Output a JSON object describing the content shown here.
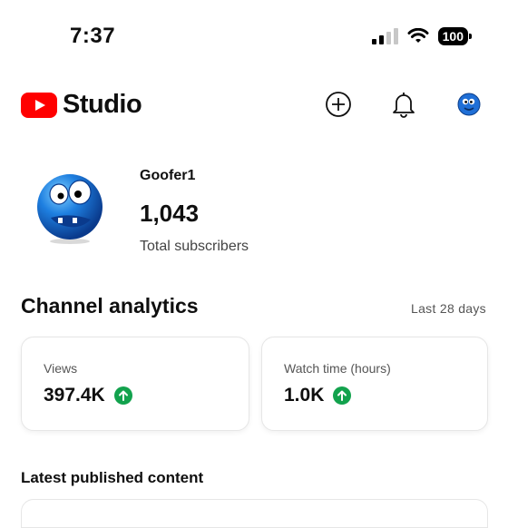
{
  "status_bar": {
    "time": "7:37",
    "battery": "100"
  },
  "header": {
    "brand": "Studio",
    "icons": [
      "create-icon",
      "bell-icon",
      "avatar"
    ]
  },
  "channel": {
    "name": "Goofer1",
    "subscriber_count": "1,043",
    "subscriber_label": "Total subscribers"
  },
  "analytics": {
    "title": "Channel analytics",
    "period": "Last 28 days",
    "cards": [
      {
        "label": "Views",
        "value": "397.4K",
        "trend": "up"
      },
      {
        "label": "Watch time (hours)",
        "value": "1.0K",
        "trend": "up"
      }
    ]
  },
  "latest": {
    "title": "Latest published content"
  },
  "colors": {
    "brand_red": "#ff0000",
    "up_green": "#12a24d"
  }
}
